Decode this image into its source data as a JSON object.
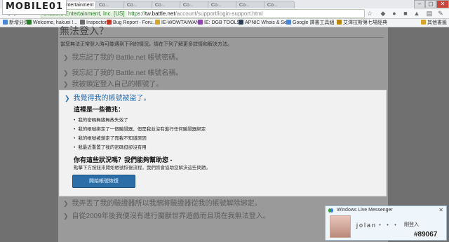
{
  "brand": {
    "logo_text": "MOBILE01"
  },
  "tabs": [
    {
      "label": "Blizzard Entertainment"
    },
    {
      "label": "Co..."
    },
    {
      "label": "Co..."
    },
    {
      "label": "Co..."
    },
    {
      "label": "Co..."
    },
    {
      "label": "Co..."
    },
    {
      "label": "Co..."
    },
    {
      "label": "Co..."
    }
  ],
  "omnibox": {
    "ev_badge": "Blizzard Entertainment, Inc. [US]",
    "scheme": "https://",
    "host": "tw.battle.net",
    "path": "/account/support/login-support.html"
  },
  "bookmarks": [
    {
      "label": "新增分頁",
      "color": "#4a86d4"
    },
    {
      "label": "Welcome, hakuei !...",
      "color": "#2a7a2a"
    },
    {
      "label": "Inspector",
      "color": "#6b6b6b"
    },
    {
      "label": "Bug Report - Foru...",
      "color": "#c0392b"
    },
    {
      "label": "IE-WOWTAIWAN",
      "color": "#d4a62a"
    },
    {
      "label": "IE: DGB TOOLS",
      "color": "#8e44ad"
    },
    {
      "label": "APNIC Whois & Se...",
      "color": "#2c3e50"
    },
    {
      "label": "Google 譯書工具組",
      "color": "#4a86d4"
    },
    {
      "label": "艾澤拉斯第七場經典",
      "color": "#b8860b"
    },
    {
      "label": "其他書籤",
      "color": "#d4a62a"
    }
  ],
  "page": {
    "title": "無法登入？",
    "intro": "當您無法正常登入時可能遇到下列的情況，請在下列了解更多詳情和解決方法。",
    "options_top": [
      "我忘記了我的 Battle.net 帳號密碼。",
      "我忘記了我的 Battle.net 帳號名稱。",
      "我被鎖定登入自己的帳號了。"
    ],
    "panel": {
      "heading": "我覺得我的帳號被盜了。",
      "subheading": "這裡是一些徵兆：",
      "bullets": [
        "我的密碼無緣無故失效了",
        "我的帳號綁定了一個驗證器，但是我並沒有進行任何驗證器綁定",
        "我的帳號被鎖定了而我不知道原因",
        "我最近重置了我的密碼但卻沒有用"
      ],
      "question": "你有這些狀況嗎？我們能夠幫助您 -",
      "note": "點擊下方按鈕來開始帳號恢復流程，我們將會協助您解決這些問題。",
      "button_label": "開始帳號恢復"
    },
    "options_bottom": [
      "我弄丟了我的驗證器所以我想將驗證器從我的帳號解除綁定。",
      "自從2009年後我便沒有進行魔獸世界遊戲而且現在我無法登入。"
    ]
  },
  "messenger": {
    "title": "Windows Live Messenger",
    "contact_name": "jolan・・・",
    "status_text": "剛登入"
  },
  "watermark": "#89067"
}
